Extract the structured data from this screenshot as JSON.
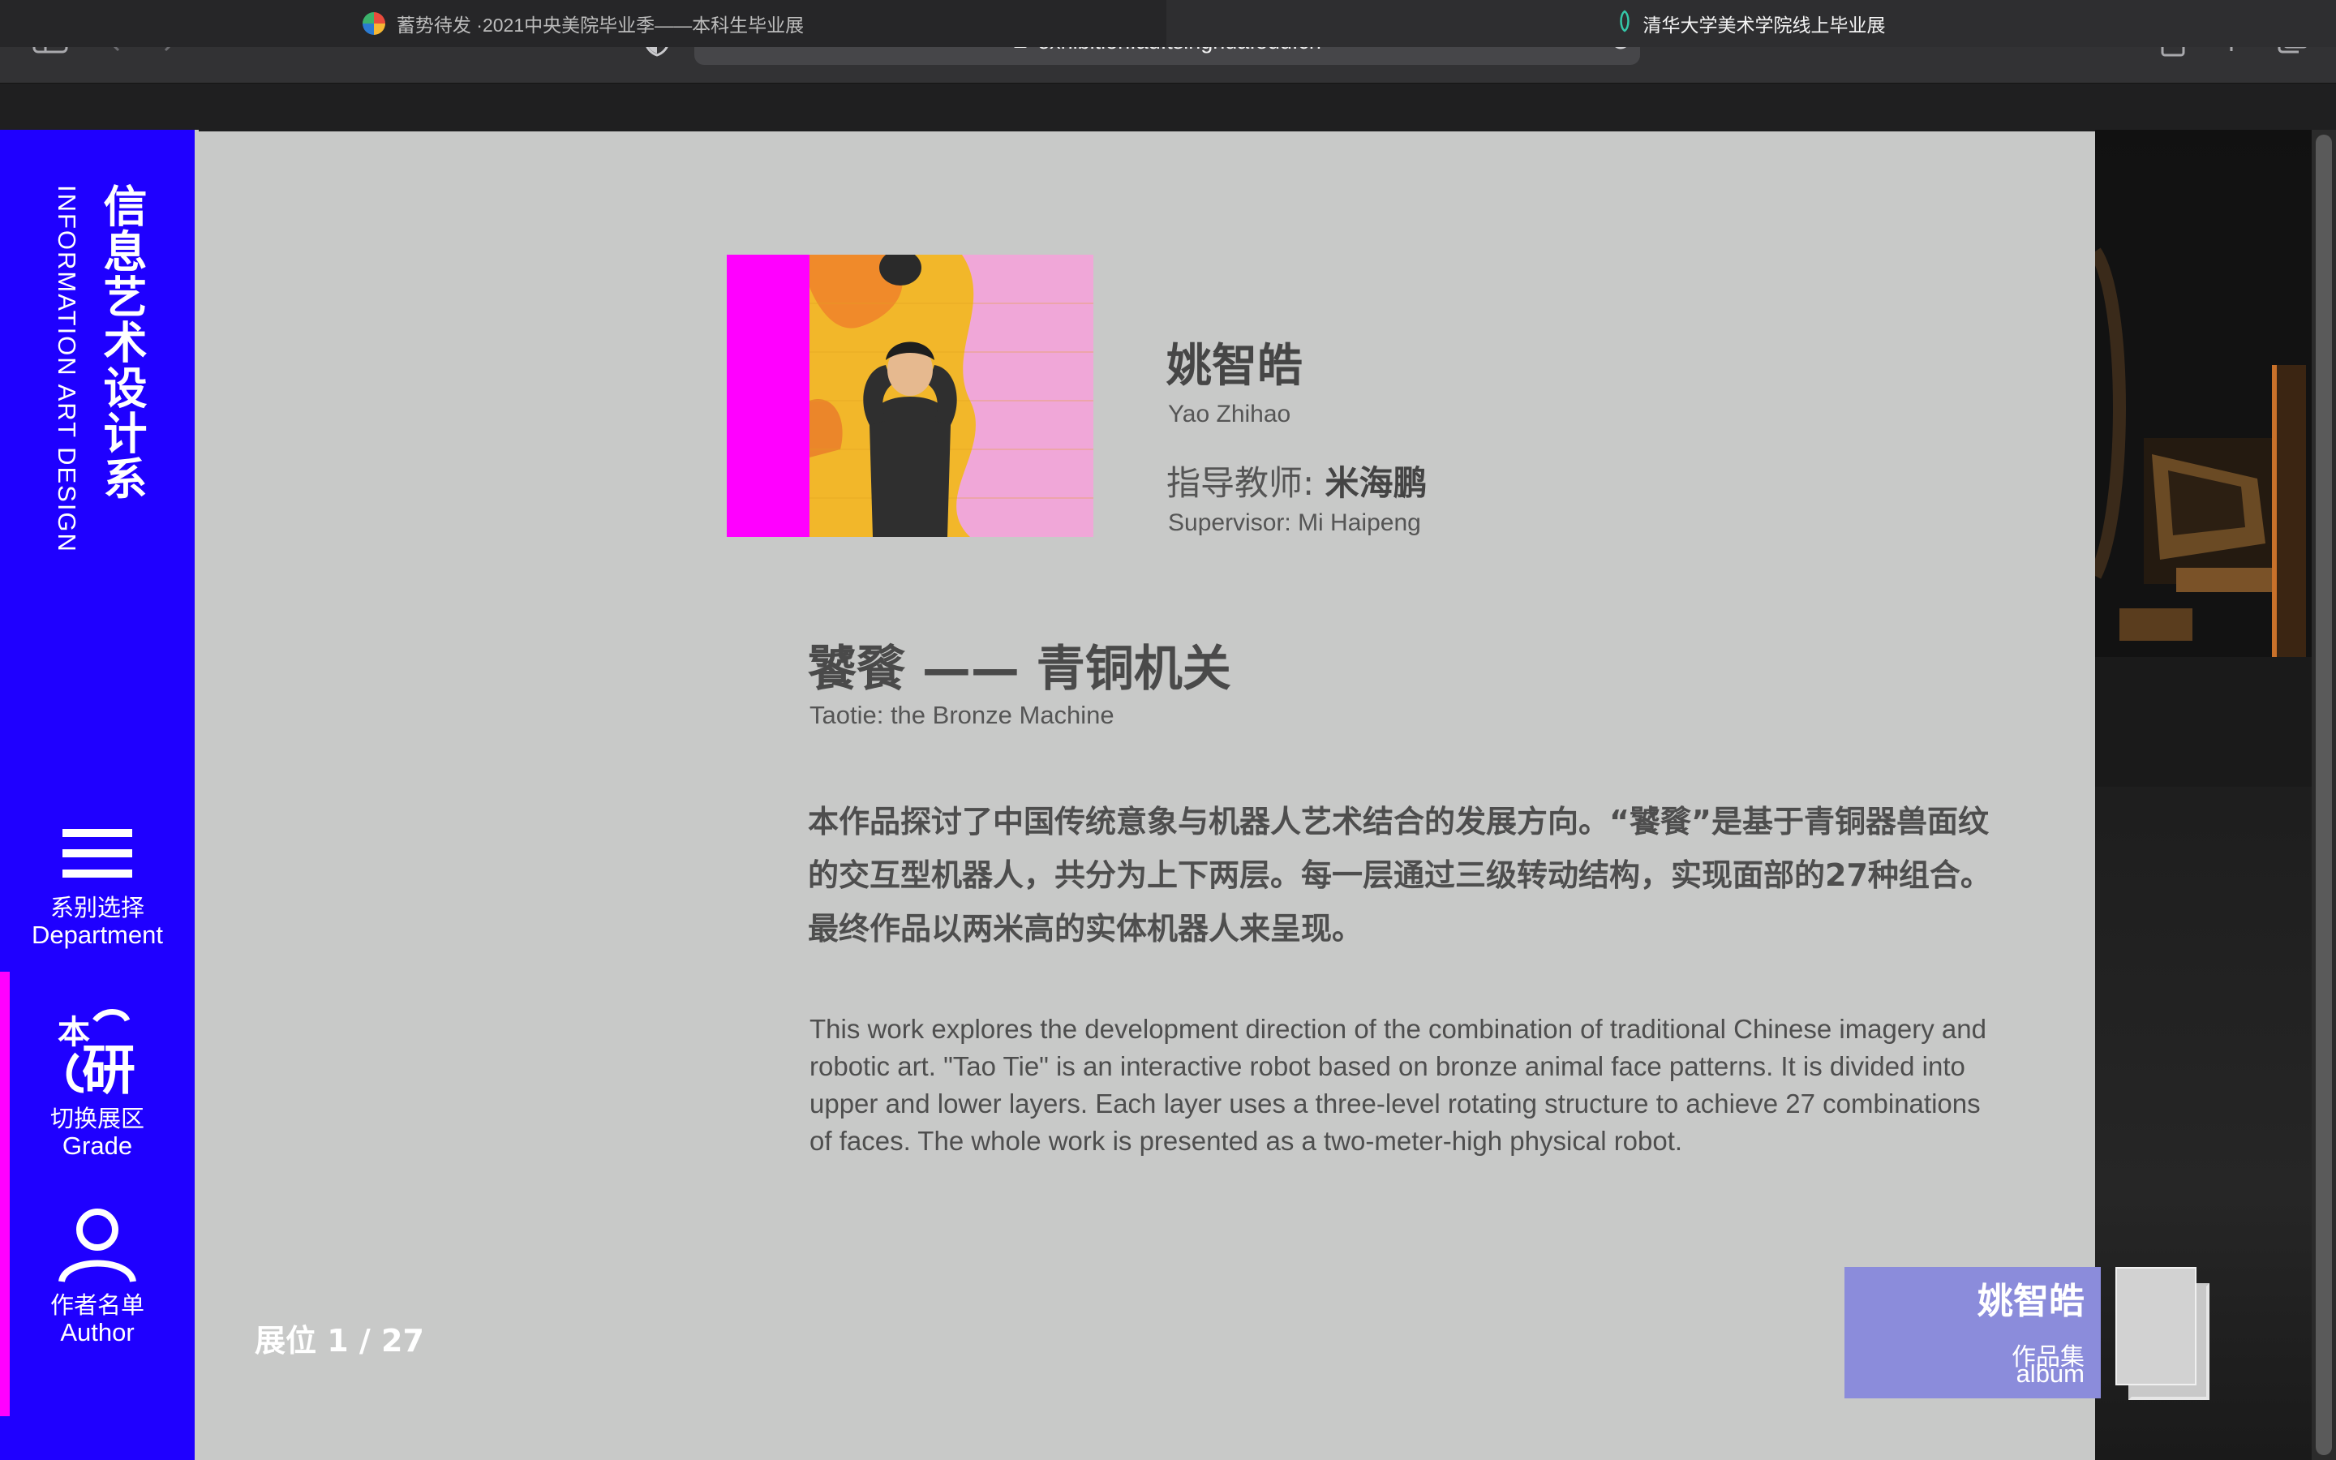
{
  "browser": {
    "url": "exhibition.ad.tsinghua.edu.cn",
    "tabs": [
      {
        "label": "蓄势待发 ·2021中央美院毕业季——本科生毕业展"
      },
      {
        "label": "清华大学美术学院线上毕业展"
      }
    ]
  },
  "sidebar": {
    "department_zh": "信息艺术设计系",
    "department_en": "INFORMATION ART DESIGN",
    "nav": [
      {
        "zh": "系别选择",
        "en": "Department",
        "icon": "menu-icon"
      },
      {
        "zh": "切换展区",
        "en": "Grade",
        "icon": "grade-switch-icon",
        "glyph_top": "本",
        "glyph_main": "研"
      },
      {
        "zh": "作者名单",
        "en": "Author",
        "icon": "person-icon"
      }
    ]
  },
  "artist": {
    "name_zh": "姚智皓",
    "name_en": "Yao Zhihao",
    "supervisor_label_zh": "指导教师:",
    "supervisor_zh": "米海鹏",
    "supervisor_en": "Supervisor: Mi Haipeng"
  },
  "work": {
    "title_zh": "饕餮 —— 青铜机关",
    "title_en": "Taotie: the Bronze Machine",
    "description_zh": "本作品探讨了中国传统意象与机器人艺术结合的发展方向。“饕餮”是基于青铜器兽面纹的交互型机器人，共分为上下两层。每一层通过三级转动结构，实现面部的27种组合。最终作品以两米高的实体机器人来呈现。",
    "description_en": "This work explores the development direction of the combination of traditional Chinese imagery and robotic art. \"Tao Tie\" is an interactive robot based on bronze animal face patterns. It is divided into upper and lower layers. Each layer uses a three-level rotating structure to achieve 27 combinations of faces. The whole work is presented as a two-meter-high physical robot."
  },
  "booth": "展位 1 / 27",
  "album": {
    "name": "姚智皓",
    "label_zh": "作品集",
    "label_en": "album"
  },
  "colors": {
    "sidebar": "#1f00ff",
    "accent_magenta": "#ff00ff",
    "panel": "#c8c9c8",
    "album": "#8b8cdb"
  }
}
